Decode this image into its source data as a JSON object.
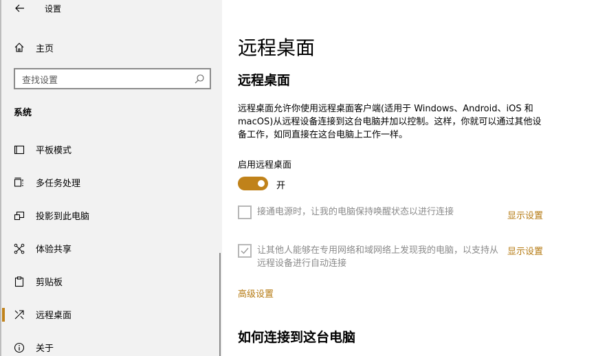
{
  "window": {
    "title": "设置"
  },
  "sidebar": {
    "home_label": "主页",
    "search_placeholder": "查找设置",
    "section_title": "系统",
    "items": [
      {
        "label": "平板模式",
        "icon": "tablet-mode-icon"
      },
      {
        "label": "多任务处理",
        "icon": "multitasking-icon"
      },
      {
        "label": "投影到此电脑",
        "icon": "project-to-pc-icon"
      },
      {
        "label": "体验共享",
        "icon": "shared-experiences-icon"
      },
      {
        "label": "剪贴板",
        "icon": "clipboard-icon"
      },
      {
        "label": "远程桌面",
        "icon": "remote-desktop-icon",
        "active": true
      },
      {
        "label": "关于",
        "icon": "info-icon"
      }
    ]
  },
  "main": {
    "page_title": "远程桌面",
    "sub_title": "远程桌面",
    "description": "远程桌面允许你使用远程桌面客户端(适用于 Windows、Android、iOS 和 macOS)从远程设备连接到这台电脑并加以控制。这样，你就可以通过其他设备工作，如同直接在这台电脑上工作一样。",
    "enable_label": "启用远程桌面",
    "toggle_state": "开",
    "toggle_on": true,
    "option1": {
      "text": "接通电源时，让我的电脑保持唤醒状态以进行连接",
      "checked": false,
      "link": "显示设置"
    },
    "option2": {
      "text": "让其他人能够在专用网络和域网络上发现我的电脑，以支持从远程设备进行自动连接",
      "checked": true,
      "link": "显示设置"
    },
    "advanced_link": "高级设置",
    "how_title": "如何连接到这台电脑"
  },
  "colors": {
    "accent": "#c0821a",
    "link": "#b57a12",
    "sidebar_bg": "#f2f2f2"
  }
}
